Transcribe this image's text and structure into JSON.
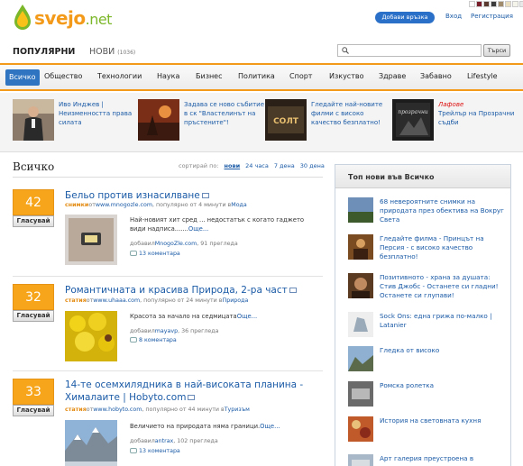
{
  "header": {
    "logo_text": "svejo",
    "logo_tld": ".net",
    "add_link": "Добави връзка",
    "login": "Вход",
    "register": "Регистрация",
    "swatch_colors": [
      "#ffffff",
      "#7a1d2a",
      "#5a3a2e",
      "#3b3b3b",
      "#a08c6c",
      "#e9dfc0",
      "#f4f4ea",
      "#e8e8e8"
    ]
  },
  "tabs": {
    "popular": "ПОПУЛЯРНИ",
    "new": "НОВИ",
    "new_count": "(1036)",
    "search_placeholder": "",
    "search_button": "Търси"
  },
  "categories": [
    "Всичко",
    "Общество",
    "Технологии",
    "Наука",
    "Бизнес",
    "Политика",
    "Спорт",
    "Изкуство",
    "Здраве",
    "Забавно",
    "Lifestyle"
  ],
  "featured": [
    {
      "tag": "",
      "title": "Иво Инджев | Неизменността права силата"
    },
    {
      "tag": "",
      "title": "Задава се ново събитие в ск \"Властелинът на пръстените\"!"
    },
    {
      "tag": "",
      "title": "Гледайте най-новите филми с високо качество безплатно!"
    },
    {
      "tag": "Лафове",
      "title": "Трейлър на Прозрачни съдби"
    }
  ],
  "main": {
    "title": "Всичко",
    "sort_label": "сортирай по:",
    "sort_options": [
      "нови",
      "24 часа",
      "7 дена",
      "30 дена"
    ],
    "vote_label": "Гласувай",
    "items": [
      {
        "votes": "42",
        "title": "Бельо против изнасилване",
        "category": "снимки",
        "from_text": "от",
        "source": "www.mnogozle.com",
        "popular_text": ", популярно от 4 минути в",
        "section": "Мода",
        "description": "Най-новият хит сред ... недостатък с когато гаджето види надписа.......",
        "more": "Още...",
        "added_by_label": "добавил",
        "added_by": "MnogoZle.com",
        "views_text": ", 91 прегледа",
        "comments": "13 коментара"
      },
      {
        "votes": "32",
        "title": "Романтичната и красива Природа, 2-ра част",
        "category": "статия",
        "from_text": "от",
        "source": "www.uhaaa.com",
        "popular_text": ", популярно от 24 минути в",
        "section": "Природа",
        "description": "Красота за начало на седмицата",
        "more": "Още...",
        "added_by_label": "добавил",
        "added_by": "mayavp",
        "views_text": ", 36 прегледа",
        "comments": "8 коментара"
      },
      {
        "votes": "33",
        "title": "14-те осемхилядника в най-високата планина - Хималаите | Hobyto.com",
        "category": "статия",
        "from_text": "от",
        "source": "www.hobyto.com",
        "popular_text": ", популярно от 44 минути в",
        "section": "Туризъм",
        "description": "Величието на природата няма граници.",
        "more": "Още...",
        "added_by_label": "добавил",
        "added_by": "antrax",
        "views_text": ", 102 прегледа",
        "comments": "13 коментара"
      }
    ]
  },
  "sidebar": {
    "title": "Топ нови във Всичко",
    "items": [
      "68 невероятните снимки на природата през обектива на Вокруг Света",
      "Гледайте филма - Принцът на Персия - с високо качество безплатно!",
      "Позитивното - храна за душата: Стив Джобс - Останете си гладни! Останете си глупави!",
      "Sock Ons: една грижа по-малко | Latanier",
      "Гледка от високо",
      "Ромска ролетка",
      "История на световната кухня",
      "Арт галерия преустроена в"
    ]
  }
}
